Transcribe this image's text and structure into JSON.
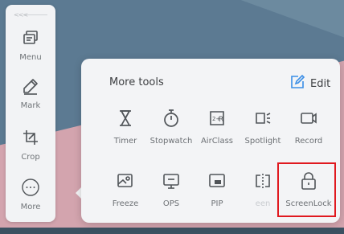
{
  "sidebar": {
    "collapse_glyph": "<<<",
    "items": [
      {
        "label": "Menu",
        "icon": "menu-icon"
      },
      {
        "label": "Mark",
        "icon": "pen-icon"
      },
      {
        "label": "Crop",
        "icon": "crop-icon"
      },
      {
        "label": "More",
        "icon": "more-icon"
      }
    ]
  },
  "panel": {
    "title": "More tools",
    "edit_label": "Edit",
    "tools_row1": [
      {
        "label": "Timer",
        "icon": "hourglass-icon"
      },
      {
        "label": "Stopwatch",
        "icon": "stopwatch-icon"
      },
      {
        "label": "AirClass",
        "icon": "airclass-icon"
      },
      {
        "label": "Spotlight",
        "icon": "spotlight-icon"
      },
      {
        "label": "Record",
        "icon": "record-icon"
      }
    ],
    "tools_row2": [
      {
        "label": "Freeze",
        "icon": "freeze-icon"
      },
      {
        "label": "OPS",
        "icon": "ops-icon"
      },
      {
        "label": "PIP",
        "icon": "pip-icon"
      },
      {
        "label": "een",
        "icon": "split-screen-icon"
      },
      {
        "label": "ScreenLock",
        "icon": "lock-icon"
      }
    ]
  },
  "colors": {
    "highlight": "#e0191f",
    "accent": "#3a8ee6"
  }
}
